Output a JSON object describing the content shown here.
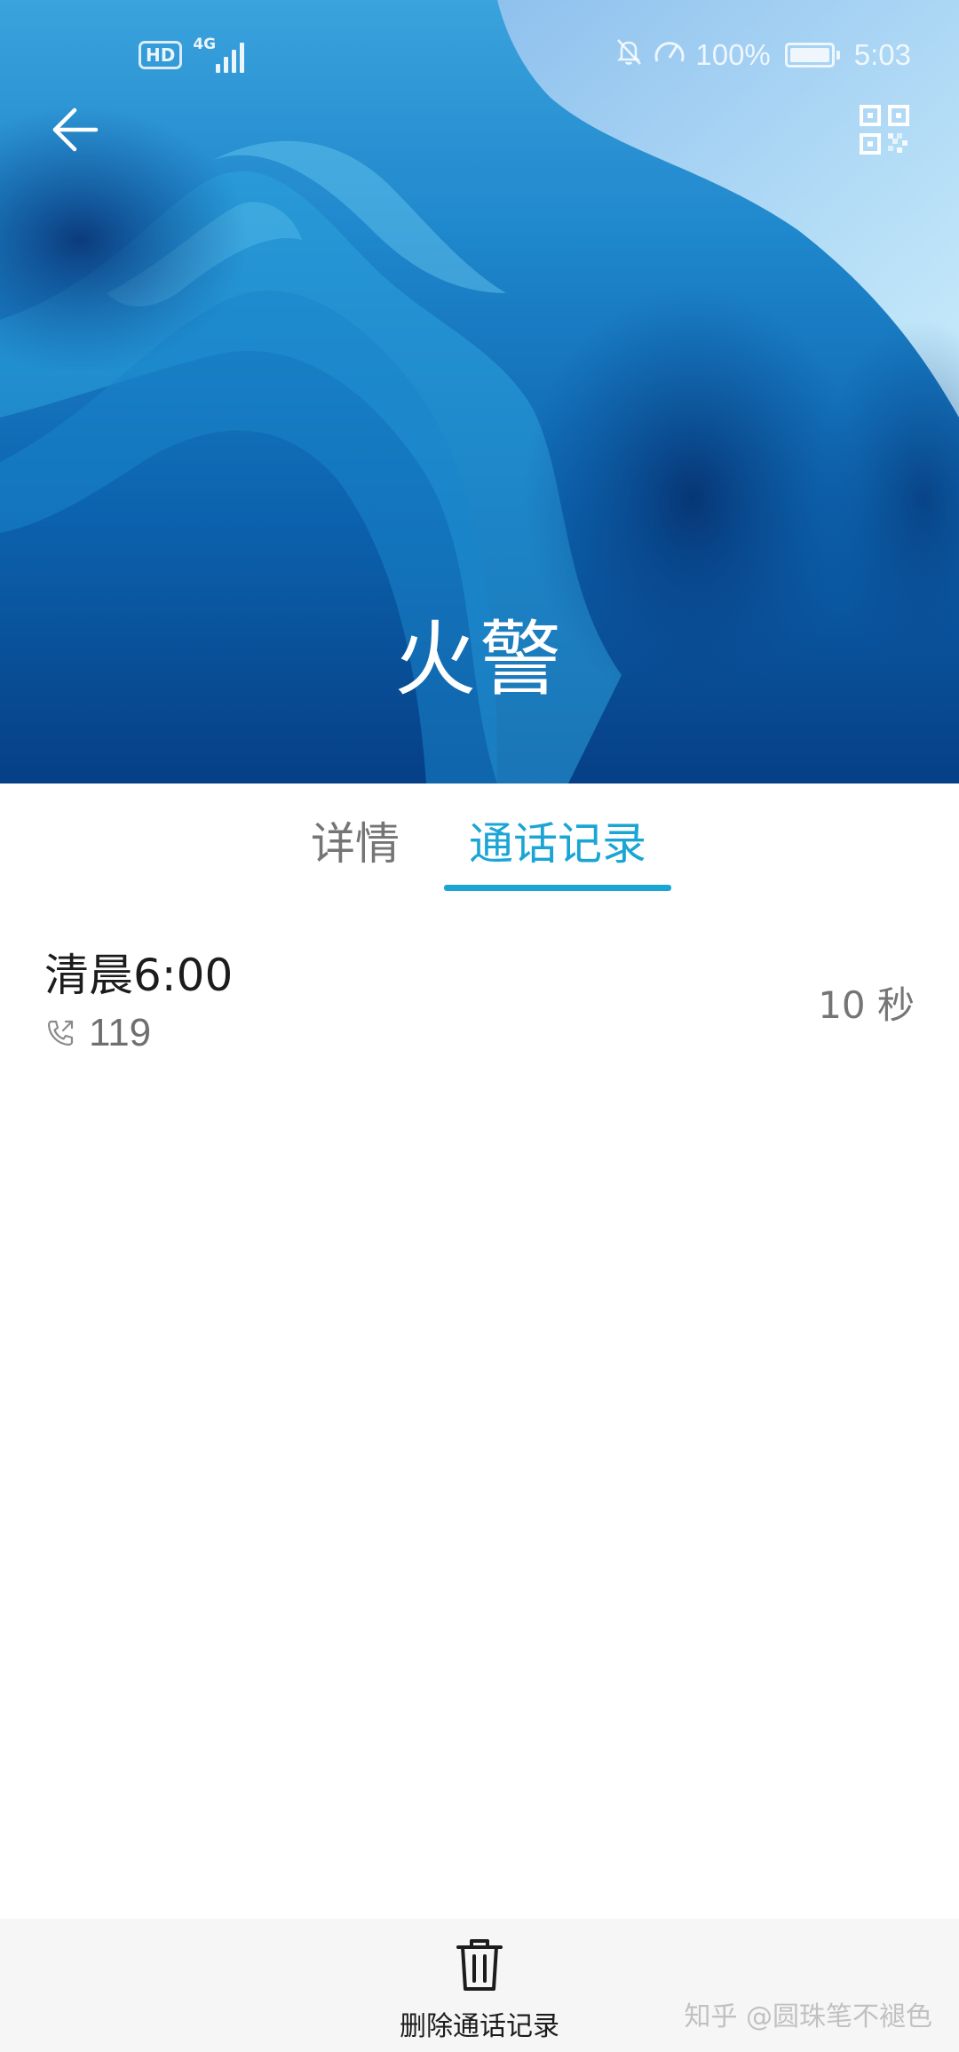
{
  "status_bar": {
    "hd_badge": "HD",
    "network_label": "4G",
    "battery_percent": "100%",
    "time": "5:03",
    "icons": [
      "mute-bell-icon",
      "speed-gauge-icon",
      "battery-icon",
      "signal-icon"
    ]
  },
  "header": {
    "back_icon": "arrow-left-icon",
    "qr_icon": "qr-code-icon",
    "contact_name": "火警"
  },
  "tabs": [
    {
      "label": "详情",
      "active": false
    },
    {
      "label": "通话记录",
      "active": true
    }
  ],
  "call_log": [
    {
      "time": "清晨6:00",
      "number": "119",
      "duration": "10 秒",
      "direction_icon": "outgoing-call-icon"
    }
  ],
  "bottom_bar": {
    "delete_label": "删除通话记录",
    "delete_icon": "trash-icon"
  },
  "watermark": "知乎 @圆珠笔不褪色",
  "colors": {
    "accent": "#1aa5d4",
    "header_top": "#3aa2dc",
    "header_bottom": "#063f86",
    "bottom_bar_bg": "#f6f6f6"
  }
}
